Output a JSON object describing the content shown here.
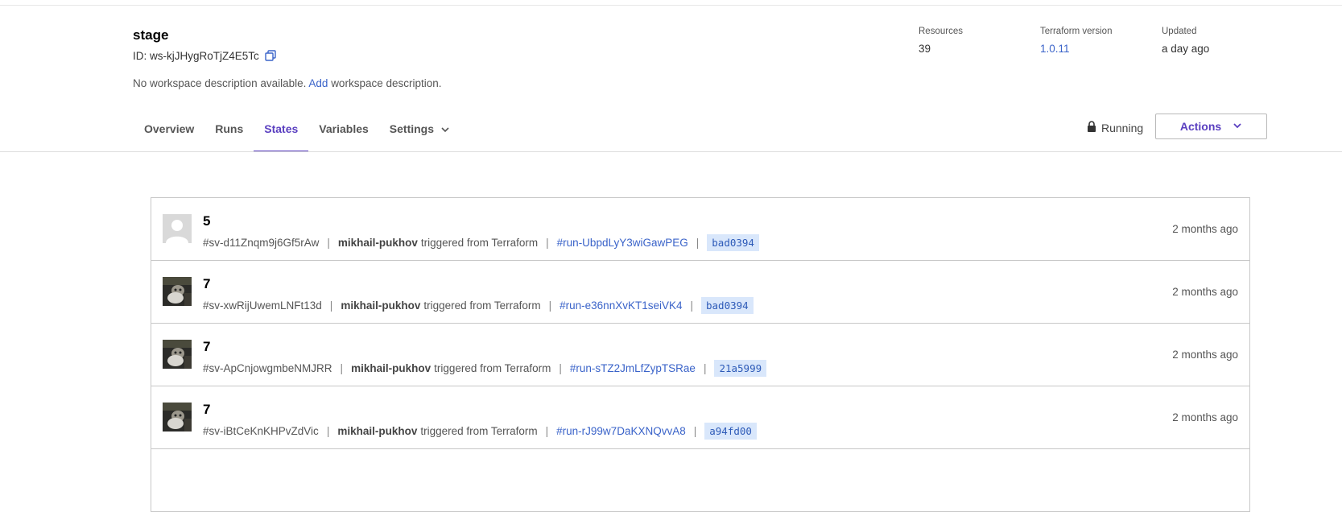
{
  "workspace": {
    "title": "stage",
    "id_text": "ID: ws-kjJHygRoTjZ4E5Tc",
    "desc_prefix": "No workspace description available.",
    "desc_link": "Add",
    "desc_suffix": "workspace description."
  },
  "meta": {
    "resources_label": "Resources",
    "resources_value": "39",
    "tf_label": "Terraform version",
    "tf_value": "1.0.11",
    "updated_label": "Updated",
    "updated_value": "a day ago"
  },
  "tabs": [
    {
      "label": "Overview"
    },
    {
      "label": "Runs"
    },
    {
      "label": "States"
    },
    {
      "label": "Variables"
    },
    {
      "label": "Settings"
    }
  ],
  "status": {
    "label": "Running",
    "icon": "lock-icon"
  },
  "actions": {
    "label": "Actions"
  },
  "colors": {
    "accent": "#5a3fc0",
    "link": "#3a63c9",
    "sha_bg": "#d9e7fb"
  },
  "states": [
    {
      "serial": "5",
      "sv_id": "#sv-d11Znqm9j6Gf5rAw",
      "user": "mikhail-pukhov",
      "trigger": "triggered from Terraform",
      "run": "#run-UbpdLyY3wiGawPEG",
      "sha": "bad0394",
      "time": "2 months ago",
      "avatar": "default"
    },
    {
      "serial": "7",
      "sv_id": "#sv-xwRijUwemLNFt13d",
      "user": "mikhail-pukhov",
      "trigger": "triggered from Terraform",
      "run": "#run-e36nnXvKT1seiVK4",
      "sha": "bad0394",
      "time": "2 months ago",
      "avatar": "photo"
    },
    {
      "serial": "7",
      "sv_id": "#sv-ApCnjowgmbeNMJRR",
      "user": "mikhail-pukhov",
      "trigger": "triggered from Terraform",
      "run": "#run-sTZ2JmLfZypTSRae",
      "sha": "21a5999",
      "time": "2 months ago",
      "avatar": "photo"
    },
    {
      "serial": "7",
      "sv_id": "#sv-iBtCeKnKHPvZdVic",
      "user": "mikhail-pukhov",
      "trigger": "triggered from Terraform",
      "run": "#run-rJ99w7DaKXNQvvA8",
      "sha": "a94fd00",
      "time": "2 months ago",
      "avatar": "photo"
    }
  ]
}
